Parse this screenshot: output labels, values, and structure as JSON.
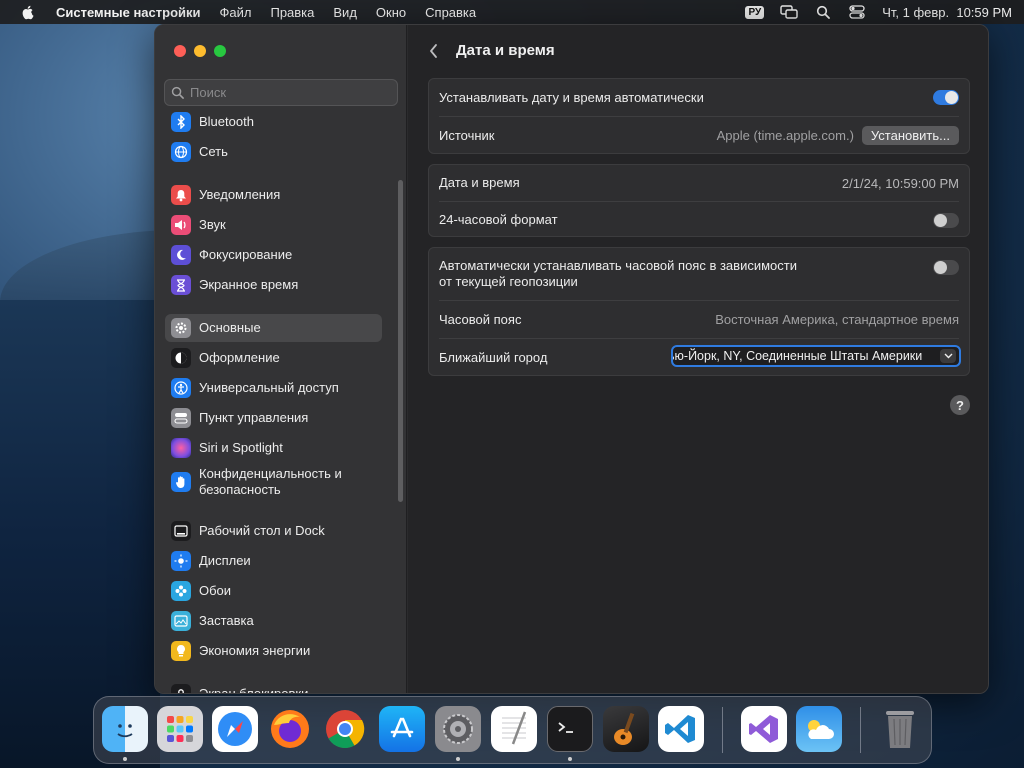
{
  "menubar": {
    "app_name": "Системные настройки",
    "menus": [
      "Файл",
      "Правка",
      "Вид",
      "Окно",
      "Справка"
    ],
    "input_source": "РУ",
    "datetime": "Чт, 1 февр.  10:59 PM"
  },
  "sidebar": {
    "search_placeholder": "Поиск",
    "items": [
      {
        "label": "Bluetooth",
        "icon": "bluetooth-icon",
        "color": "#1f7cf0"
      },
      {
        "label": "Сеть",
        "icon": "globe-icon",
        "color": "#1f7cf0"
      },
      {
        "label": "Уведомления",
        "icon": "bell-icon",
        "color": "#eb4d4b"
      },
      {
        "label": "Звук",
        "icon": "speaker-icon",
        "color": "#eb4d77"
      },
      {
        "label": "Фокусирование",
        "icon": "moon-icon",
        "color": "#5d4fd6"
      },
      {
        "label": "Экранное время",
        "icon": "hourglass-icon",
        "color": "#6a4fd6"
      },
      {
        "label": "Основные",
        "icon": "gear-icon",
        "color": "#8e8e93"
      },
      {
        "label": "Оформление",
        "icon": "appearance-icon",
        "color": "#1c1c1e"
      },
      {
        "label": "Универсальный доступ",
        "icon": "accessibility-icon",
        "color": "#1f7cf0"
      },
      {
        "label": "Пункт управления",
        "icon": "control-center-icon",
        "color": "#8e8e93"
      },
      {
        "label": "Siri и Spotlight",
        "icon": "siri-icon",
        "color": "#b04fd6"
      },
      {
        "label": "Конфиденциальность и безопасность",
        "icon": "hand-icon",
        "color": "#1f7cf0"
      },
      {
        "label": "Рабочий стол и Dock",
        "icon": "dock-icon",
        "color": "#1c1c1e"
      },
      {
        "label": "Дисплеи",
        "icon": "sun-icon",
        "color": "#1f7cf0"
      },
      {
        "label": "Обои",
        "icon": "flower-icon",
        "color": "#2aa6e0"
      },
      {
        "label": "Заставка",
        "icon": "screensaver-icon",
        "color": "#3bb0d9"
      },
      {
        "label": "Экономия энергии",
        "icon": "bulb-icon",
        "color": "#f2b81d"
      },
      {
        "label": "Экран блокировки",
        "icon": "lock-icon",
        "color": "#1c1c1e"
      }
    ]
  },
  "main": {
    "title": "Дата и время",
    "auto_datetime_label": "Устанавливать дату и время автоматически",
    "auto_datetime_on": true,
    "source_label": "Источник",
    "source_value": "Apple (time.apple.com.)",
    "set_button": "Установить...",
    "datetime_label": "Дата и время",
    "datetime_value": "2/1/24, 10:59:00 PM",
    "format24_label": "24-часовой формат",
    "format24_on": false,
    "auto_tz_label_1": "Автоматически устанавливать часовой пояс в зависимости",
    "auto_tz_label_2": "от текущей геопозиции",
    "auto_tz_on": false,
    "timezone_label": "Часовой пояс",
    "timezone_value": "Восточная Америка, стандартное время",
    "city_label": "Ближайший город",
    "city_value": "Нью-Йорк, NY, Соединенные Штаты Америки",
    "help": "?"
  },
  "dock": {
    "apps": [
      "finder-icon",
      "launchpad-icon",
      "safari-icon",
      "firefox-icon",
      "chrome-icon",
      "app-store-icon",
      "system-settings-icon",
      "textedit-icon",
      "terminal-icon",
      "garageband-icon",
      "vscode-icon",
      "visual-studio-icon",
      "weather-icon",
      "trash-icon"
    ]
  }
}
